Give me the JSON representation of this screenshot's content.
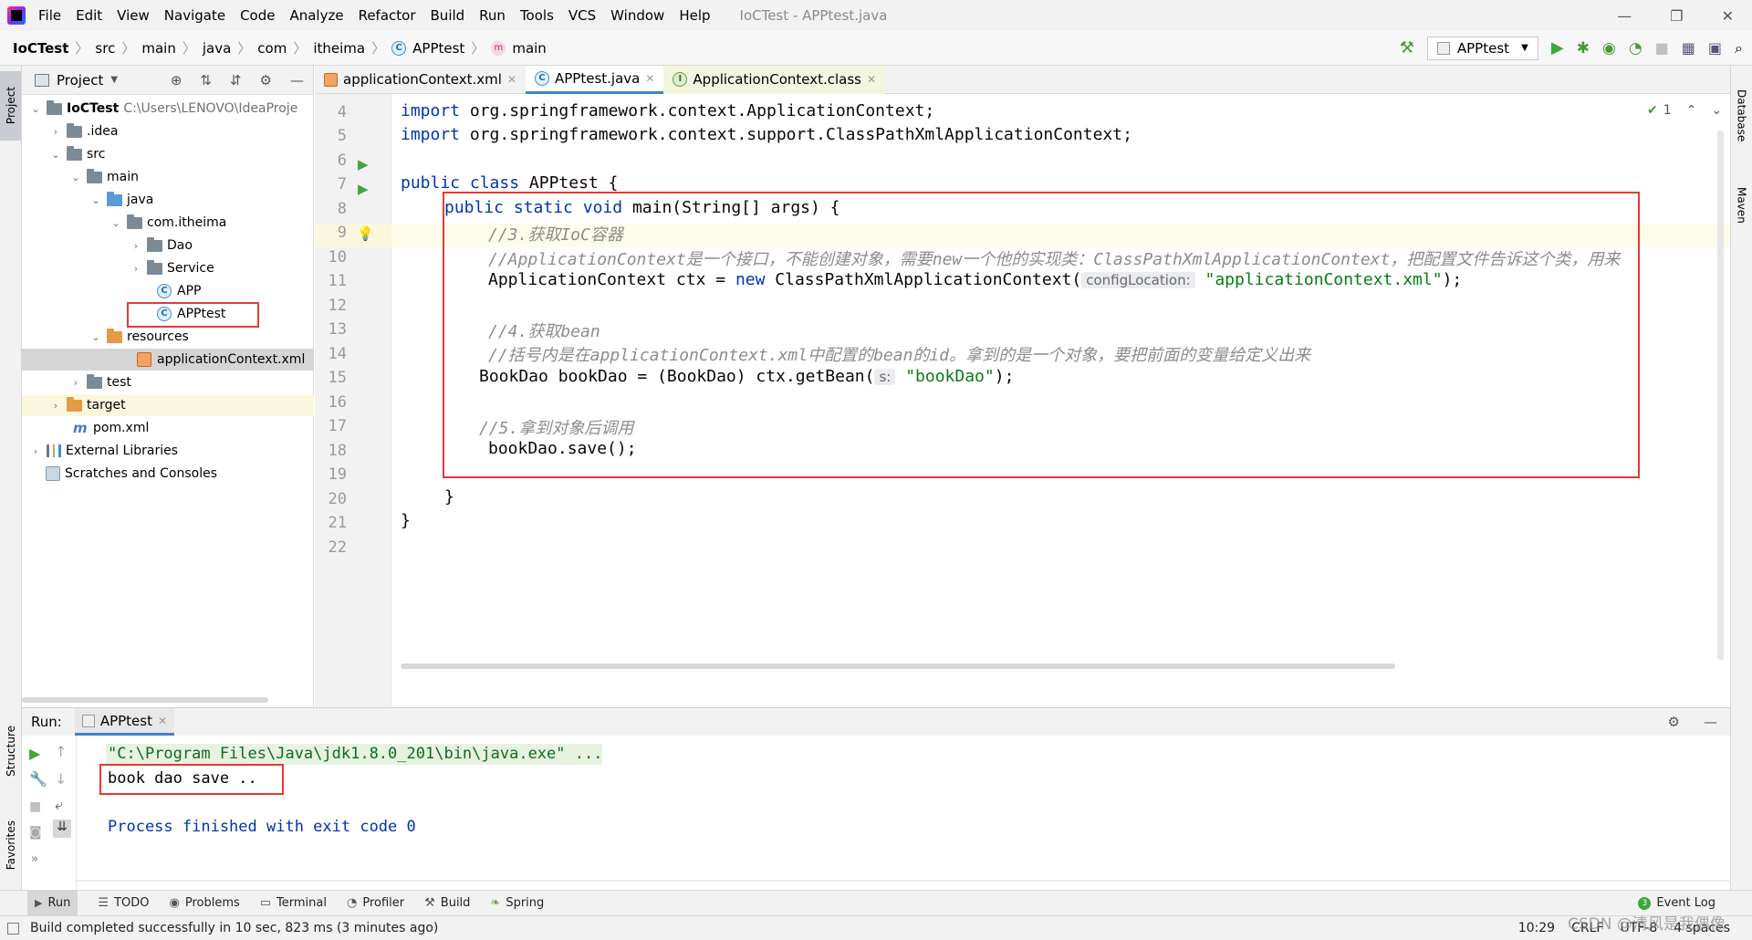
{
  "window": {
    "menus": [
      "File",
      "Edit",
      "View",
      "Navigate",
      "Code",
      "Analyze",
      "Refactor",
      "Build",
      "Run",
      "Tools",
      "VCS",
      "Window",
      "Help"
    ],
    "title": "IoCTest - APPtest.java"
  },
  "breadcrumb": {
    "items": [
      "IoCTest",
      "src",
      "main",
      "java",
      "com",
      "itheima",
      "APPtest",
      "main"
    ]
  },
  "toolbar": {
    "run_config": "APPtest"
  },
  "project": {
    "header": "Project",
    "root_name": "IoCTest",
    "root_path": "C:\\Users\\LENOVO\\IdeaProje",
    "items": [
      ".idea",
      "src",
      "main",
      "java",
      "com.itheima",
      "Dao",
      "Service",
      "APP",
      "APPtest",
      "resources",
      "applicationContext.xml",
      "test",
      "target",
      "pom.xml",
      "External Libraries",
      "Scratches and Consoles"
    ]
  },
  "left_strip": {
    "project": "Project",
    "structure": "Structure",
    "favorites": "Favorites"
  },
  "right_strip": {
    "database": "Database",
    "maven": "Maven"
  },
  "tabs": [
    "applicationContext.xml",
    "APPtest.java",
    "ApplicationContext.class"
  ],
  "editor": {
    "line_numbers": [
      "4",
      "5",
      "6",
      "7",
      "8",
      "9",
      "10",
      "11",
      "12",
      "13",
      "14",
      "15",
      "16",
      "17",
      "18",
      "19",
      "20",
      "21",
      "22"
    ],
    "inspection_count": "1",
    "l4_kw": "import",
    "l4_rest": " org.springframework.context.ApplicationContext;",
    "l5_kw": "import",
    "l5_rest": " org.springframework.context.support.ClassPathXmlApplicationContext;",
    "l7_kw1": "public",
    "l7_kw2": "class",
    "l7_rest": " APPtest {",
    "l8_kw1": "public",
    "l8_kw2": "static",
    "l8_kw3": "void",
    "l8_rest": " main(String[] args) {",
    "l9": "//3.获取IoC容器",
    "l10": "//ApplicationContext是一个接口，不能创建对象，需要new一个他的实现类：ClassPathXmlApplicationContext，把配置文件告诉这个类，用来",
    "l11_a": "ApplicationContext ctx = ",
    "l11_kw": "new",
    "l11_b": " ClassPathXmlApplicationContext(",
    "l11_hint": "configLocation:",
    "l11_str": "\"applicationContext.xml\"",
    "l11_c": ");",
    "l13": "//4.获取bean",
    "l14": "//括号内是在applicationContext.xml中配置的bean的id。拿到的是一个对象，要把前面的变量给定义出来",
    "l15_a": "BookDao bookDao = (BookDao) ctx.getBean(",
    "l15_hint": "s:",
    "l15_str": "\"bookDao\"",
    "l15_b": ");",
    "l17": "//5.拿到对象后调用",
    "l18": "bookDao.save();",
    "l20": "}",
    "l21": "}"
  },
  "run": {
    "label": "Run:",
    "tab": "APPtest",
    "cmd": "\"C:\\Program Files\\Java\\jdk1.8.0_201\\bin\\java.exe\" ...",
    "output": "book dao save ..",
    "finished": "Process finished with exit code 0"
  },
  "bottom_tabs": [
    "Run",
    "TODO",
    "Problems",
    "Terminal",
    "Profiler",
    "Build",
    "Spring"
  ],
  "event_log": "Event Log",
  "status": {
    "message": "Build completed successfully in 10 sec, 823 ms (3 minutes ago)",
    "pos": "10:29",
    "eol": "CRLF",
    "enc": "UTF-8",
    "indent": "4 spaces"
  },
  "watermark": "CSDN @清风是我偶像",
  "colors": {
    "highlight": "#e53935",
    "keyword": "#0033b3",
    "string": "#067d17",
    "comment": "#8c8c8c"
  }
}
